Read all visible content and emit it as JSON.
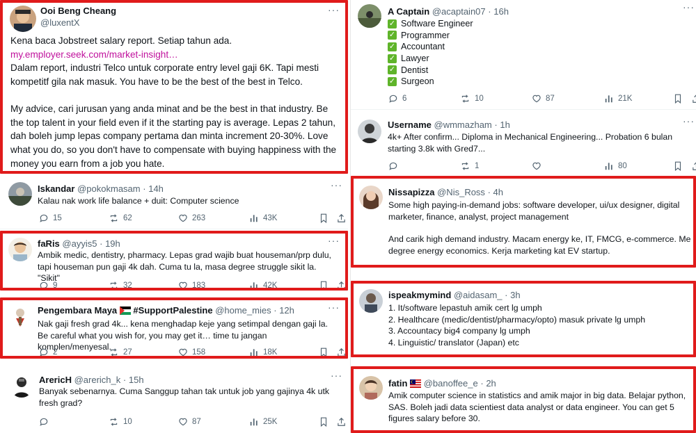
{
  "left": [
    {
      "name": "Ooi Beng Cheang",
      "handle": "@luxentX",
      "time": "",
      "lines": [
        "Kena baca Jobstreet salary report. Setiap tahun ada.",
        "my.employer.seek.com/market-insight…",
        "Dalam report, industri Telco untuk corporate entry level gaji 6K. Tapi mesti kompetitf gila nak masuk. You have to be the best of the best in Telco.",
        "My advice, cari jurusan yang anda minat and be the best in that industry. Be the top talent in your field even if it the starting pay is average. Lepas 2 tahun, dah boleh jump lepas company pertama dan minta increment 20-30%. Love what you do, so you don't have to compensate with buying happiness with the money you earn from a job you hate."
      ]
    },
    {
      "name": "Iskandar",
      "handle": "@pokokmasam",
      "time": "14h",
      "text": "Kalau nak work life balance + duit: Computer science",
      "replies": "15",
      "retweets": "62",
      "likes": "263",
      "views": "43K"
    },
    {
      "name": "faRis",
      "handle": "@ayyis5",
      "time": "19h",
      "text": "Ambik medic, dentistry, pharmacy. Lepas grad wajib buat houseman/prp dulu, tapi houseman pun gaji 4k dah. Cuma tu la, masa degree struggle sikit la. \"Sikit\"",
      "replies": "9",
      "retweets": "32",
      "likes": "183",
      "views": "42K"
    },
    {
      "name": "Pengembara Maya",
      "tag": "#SupportPalestine",
      "handle": "@home_mies",
      "time": "12h",
      "text": "Nak gaji fresh grad 4k... kena menghadap keje yang setimpal dengan gaji la. Be careful what you wish for, you may get it… time tu jangan komplen/menyesal.",
      "replies": "2",
      "retweets": "27",
      "likes": "158",
      "views": "18K"
    },
    {
      "name": "ArericH",
      "handle": "@arerich_k",
      "time": "15h",
      "text": "Banyak sebenarnya. Cuma Sanggup tahan tak untuk job yang gajinya 4k utk fresh grad?",
      "replies": "",
      "retweets": "10",
      "likes": "87",
      "views": "25K"
    }
  ],
  "right": [
    {
      "name": "A Captain",
      "handle": "@acaptain07",
      "time": "16h",
      "checklist": [
        "Software Engineer",
        "Programmer",
        "Accountant",
        "Lawyer",
        "Dentist",
        "Surgeon"
      ],
      "replies": "6",
      "retweets": "10",
      "likes": "87",
      "views": "21K"
    },
    {
      "name": "Username",
      "handle": "@wmmazham",
      "time": "1h",
      "text": "4k+ After confirm... Diploma in Mechanical Engineering... Probation 6 bulan starting 3.8k with  Gred7...",
      "replies": "",
      "retweets": "1",
      "likes": "",
      "views": "80"
    },
    {
      "name": "Nissapizza",
      "handle": "@Nis_Ross",
      "time": "4h",
      "lines": [
        "Some high paying-in-demand jobs: software developer, ui/ux designer, digital marketer, finance, analyst, project management",
        "And carik high demand industry. Macam energy ke, IT, FMCG, e-commerce. Me degree energy economics. Kerja marketing kat EV startup."
      ]
    },
    {
      "name": "ispeakmymind",
      "handle": "@aidasam_",
      "time": "3h",
      "lines": [
        "1. It/software lepastuh amik cert lg umph",
        "2. Healthcare (medic/dentist/pharmacy/opto) masuk private lg umph",
        "3. Accountacy big4 company lg umph",
        "4. Linguistic/ translator (Japan) etc"
      ]
    },
    {
      "name": "fatin",
      "handle": "@banoffee_e",
      "time": "2h",
      "text": "Amik computer science in statistics and amik major in big data. Belajar python, SAS. Boleh jadi data scientiest data analyst or data engineer. You can get 5 figures salary before 30."
    }
  ],
  "separator": "·",
  "more_glyph": "···",
  "check_glyph": "✓",
  "colors": {
    "highlight": "#e01b1b",
    "link": "#c0129d",
    "check": "#5fb42a",
    "muted": "#536471"
  }
}
